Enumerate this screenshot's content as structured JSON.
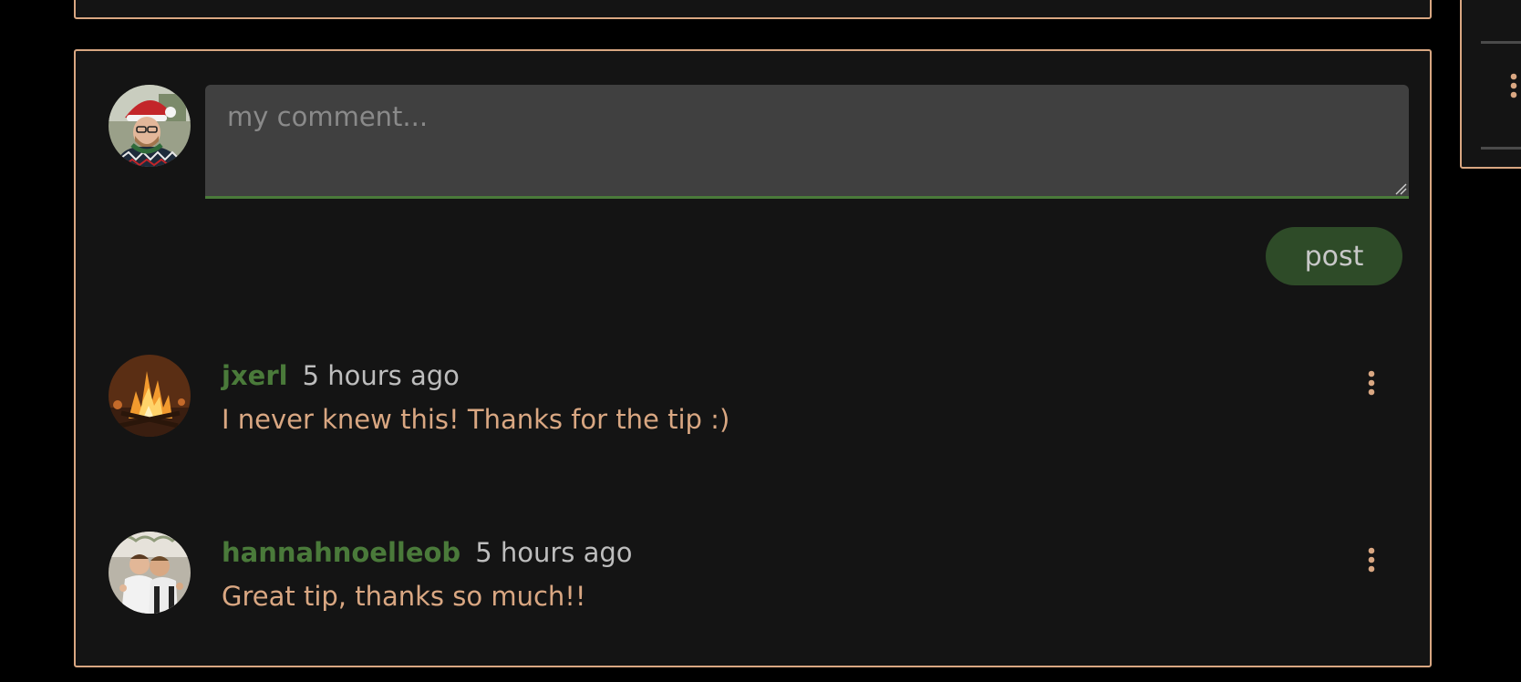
{
  "composer": {
    "placeholder": "my comment...",
    "post_label": "post"
  },
  "comments": [
    {
      "username": "jxerl",
      "time": "5 hours ago",
      "text": "I never knew this! Thanks for the tip :)"
    },
    {
      "username": "hannahnoelleob",
      "time": "5 hours ago",
      "text": "Great tip, thanks so much!!"
    }
  ],
  "colors": {
    "accent_border": "#d9a782",
    "username_green": "#4a7a3a",
    "post_button_bg": "#2e4b28",
    "card_bg": "#141414",
    "input_bg": "#404040"
  },
  "icons": {
    "comment_menu": "vertical-ellipsis-icon",
    "resize": "resize-handle-icon"
  }
}
